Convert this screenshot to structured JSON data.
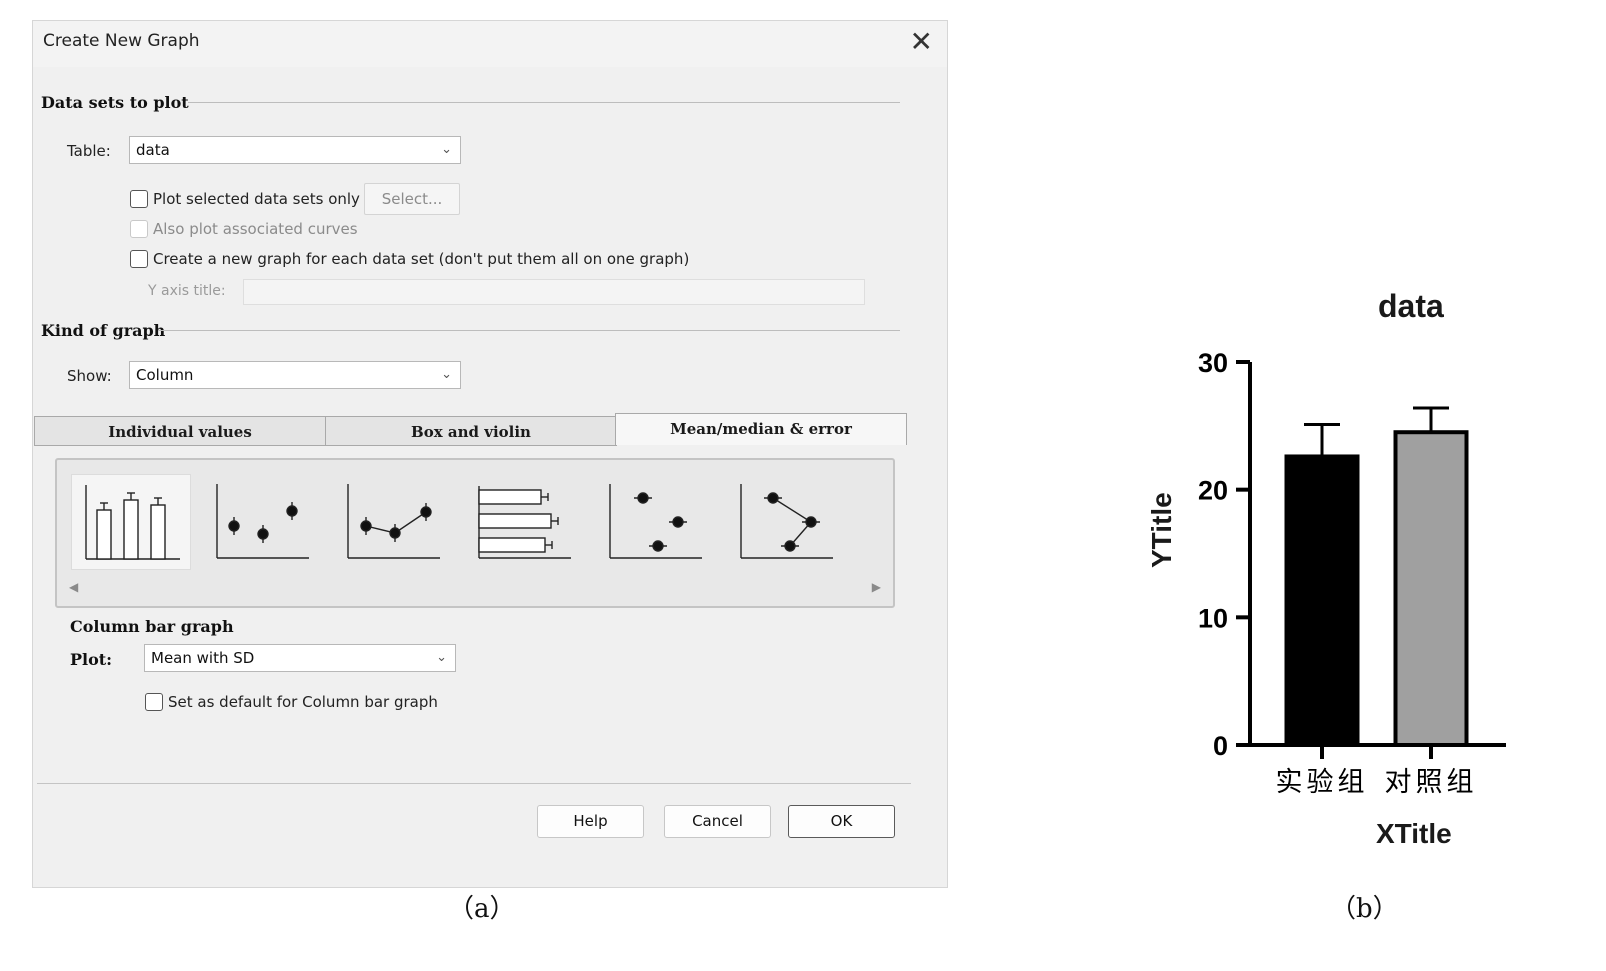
{
  "dialog": {
    "title": "Create New Graph",
    "close_glyph": "✕",
    "datasets_header": "Data sets to plot",
    "table_label": "Table:",
    "table_value": "data",
    "plot_selected_only": "Plot selected data sets only",
    "select_button": "Select...",
    "also_plot_curves": "Also plot associated curves",
    "new_graph_each": "Create a new graph for each data set (don't put them all on one graph)",
    "y_axis_title_label": "Y axis title:",
    "kind_header": "Kind of graph",
    "show_label": "Show:",
    "show_value": "Column",
    "tabs": [
      "Individual values",
      "Box and violin",
      "Mean/median & error"
    ],
    "active_tab": 2,
    "gallery_selected": 0,
    "graph_type_label": "Column bar graph",
    "plot_label": "Plot:",
    "plot_value": "Mean with SD",
    "set_default": "Set as default for Column bar graph",
    "buttons": {
      "help": "Help",
      "cancel": "Cancel",
      "ok": "OK"
    }
  },
  "captions": {
    "a": "（a）",
    "b": "（b）"
  },
  "colors": {
    "bar1": "#000000",
    "bar2": "#a0a0a0"
  },
  "chart_data": {
    "type": "bar",
    "title": "data",
    "xlabel": "XTitle",
    "ylabel": "YTitle",
    "categories": [
      "实验组",
      "对照组"
    ],
    "values": [
      22.6,
      24.5
    ],
    "error": [
      2.5,
      1.9
    ],
    "ylim": [
      0,
      30
    ],
    "yticks": [
      0,
      10,
      20,
      30
    ],
    "ytick_labels": [
      "0",
      "10",
      "20",
      "30"
    ],
    "grid": false
  }
}
